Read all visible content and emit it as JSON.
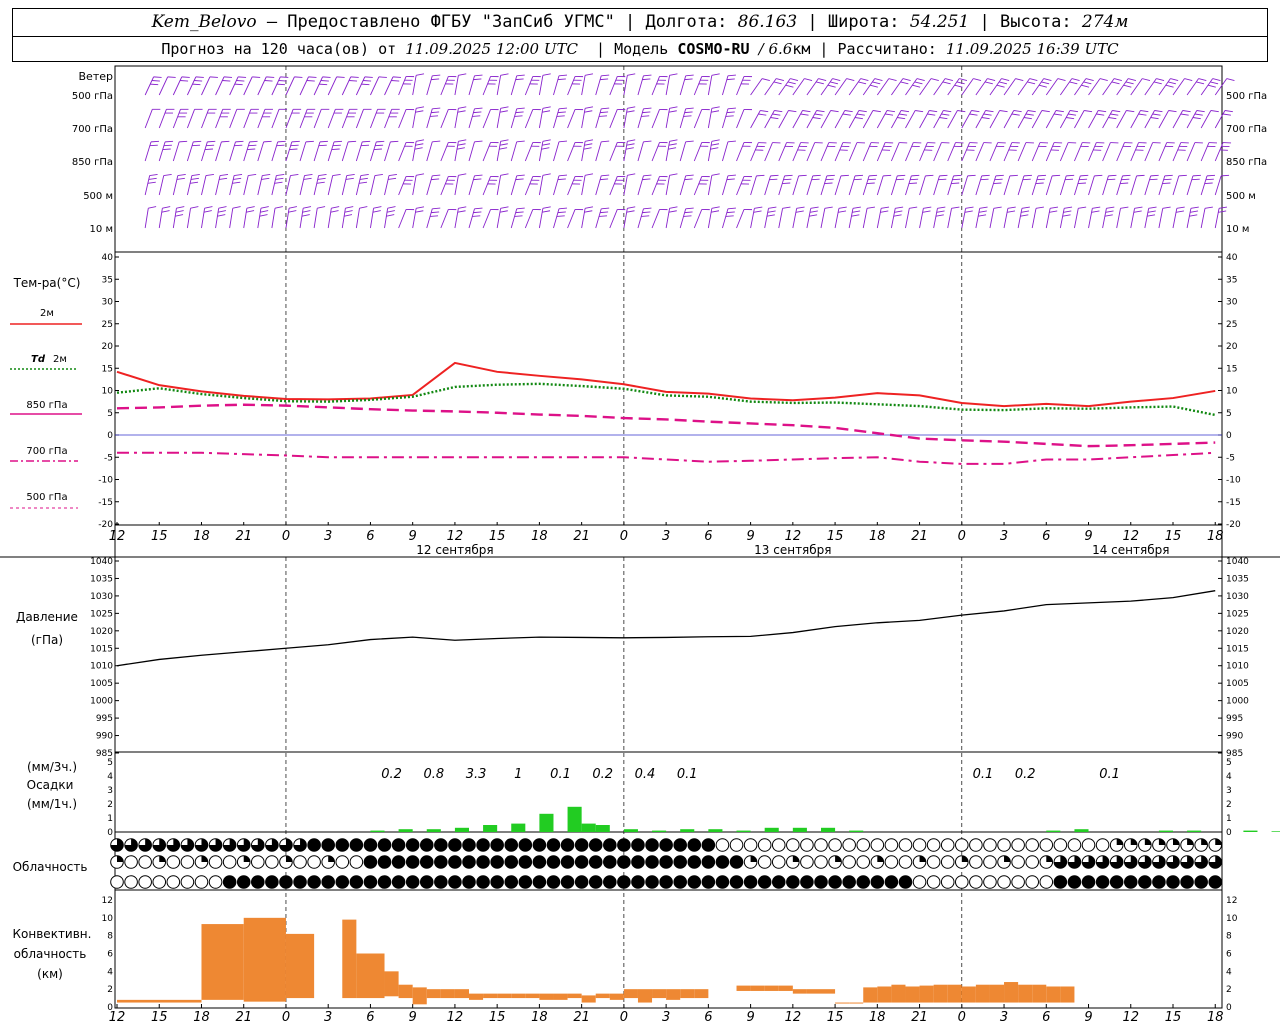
{
  "header": {
    "station": "Kem_Belovo",
    "provided_by": "– Предоставлено ФГБУ \"ЗапСиб УГМС\"",
    "lon_label": "Долгота:",
    "lon_value": "86.163",
    "lat_label": "Широта:",
    "lat_value": "54.251",
    "alt_label": "Высота:",
    "alt_value": "274м",
    "forecast_label": "Прогноз на 120 часа(ов) от",
    "forecast_from": "11.09.2025 12:00 UTC",
    "model_label": "Модель",
    "model_name": "COSMO-RU",
    "model_res": "/ 6.6",
    "model_unit": "км",
    "calc_label": "Рассчитано:",
    "calc_time": "11.09.2025 16:39 UTC"
  },
  "labels": {
    "wind_title": "Ветер",
    "wind_levels": [
      "500 гПа",
      "700 гПа",
      "850 гПа",
      "500 м",
      "10  м"
    ],
    "temp_title": "Тем-ра(°С)",
    "t2m": "2м",
    "td_a": "Td",
    "td_b": "2м",
    "t850": "850 гПа",
    "t700": "700 гПа",
    "t500": "500 гПа",
    "pressure_a": "Давление",
    "pressure_b": "(гПа)",
    "precip_a": "(мм/3ч.)",
    "precip_b": "Осадки",
    "precip_c": "(мм/1ч.)",
    "cloud": "Облачность",
    "conv_a": "Конвективн.",
    "conv_b": "облачность",
    "conv_c": "(км)"
  },
  "colors": {
    "t2m": "#ee2222",
    "td2m": "#118811",
    "t850": "#dd1188",
    "wind": "#8822cc",
    "precip": "#22cc22",
    "conv": "#ee8833",
    "zero_line": "#3333cc"
  },
  "chart_data": [
    {
      "type": "wind_barbs",
      "levels": [
        "500 гПа",
        "700 гПа",
        "850 гПа",
        "500 м",
        "10 м"
      ]
    },
    {
      "type": "line",
      "ylim": [
        -20,
        40
      ],
      "yticks": [
        -20,
        -15,
        -10,
        -5,
        0,
        5,
        10,
        15,
        20,
        25,
        30,
        35,
        40
      ],
      "x_hours_ticks": [
        0,
        3,
        6,
        9,
        12,
        15,
        18,
        21,
        24,
        27,
        30,
        33,
        36,
        39,
        42,
        45,
        48,
        51,
        54,
        57,
        60,
        63,
        66,
        69,
        72,
        75,
        78,
        81,
        84,
        87,
        90,
        93,
        96,
        99,
        102,
        105,
        108,
        111,
        114,
        117,
        120
      ],
      "x_tick_labels": [
        "12",
        "15",
        "18",
        "21",
        "0",
        "3",
        "6",
        "9",
        "12",
        "15",
        "18",
        "21",
        "0",
        "3",
        "6",
        "9",
        "12",
        "15",
        "18",
        "21",
        "0",
        "3",
        "6",
        "9",
        "12",
        "15",
        "18",
        "21",
        "0",
        "3",
        "6",
        "9",
        "12",
        "15",
        "18",
        "21",
        "0",
        "3",
        "6",
        "9",
        "12",
        "15",
        "18"
      ],
      "date_labels": [
        {
          "hour": 24,
          "text": "12 сентября"
        },
        {
          "hour": 48,
          "text": "13 сентября"
        },
        {
          "hour": 72,
          "text": "14 сентября"
        }
      ],
      "x": [
        0,
        3,
        6,
        9,
        12,
        15,
        18,
        21,
        24,
        27,
        30,
        33,
        36,
        39,
        42,
        45,
        48,
        51,
        54,
        57,
        60,
        63,
        66,
        69,
        72,
        75,
        78
      ],
      "series": [
        {
          "name": "2м",
          "values": [
            14.2,
            11.2,
            9.8,
            8.8,
            8.1,
            8.0,
            8.2,
            9.0,
            16.2,
            14.2,
            13.3,
            12.5,
            11.4,
            9.7,
            9.3,
            8.2,
            7.8,
            8.4,
            9.4,
            8.9,
            7.2,
            6.5,
            7.0,
            6.5,
            7.5,
            8.3,
            9.9
          ]
        },
        {
          "name": "Td 2м",
          "values": [
            9.5,
            10.5,
            9.2,
            8.3,
            7.6,
            7.5,
            7.9,
            8.6,
            10.8,
            11.3,
            11.5,
            11.0,
            10.4,
            8.9,
            8.6,
            7.5,
            7.2,
            7.3,
            6.9,
            6.5,
            5.7,
            5.6,
            6.0,
            5.9,
            6.2,
            6.4,
            4.5
          ]
        },
        {
          "name": "850 гПа",
          "values": [
            6.0,
            6.2,
            6.6,
            6.8,
            6.6,
            6.2,
            5.8,
            5.5,
            5.3,
            5.0,
            4.6,
            4.3,
            3.8,
            3.5,
            3.0,
            2.6,
            2.2,
            1.6,
            0.4,
            -0.8,
            -1.2,
            -1.5,
            -2.0,
            -2.5,
            -2.3,
            -2.0,
            -1.7
          ]
        },
        {
          "name": "700 гПа",
          "values": [
            -4.0,
            -4.0,
            -4.0,
            -4.3,
            -4.6,
            -5.0,
            -5.0,
            -5.0,
            -5.0,
            -5.0,
            -5.0,
            -5.0,
            -5.0,
            -5.5,
            -6.0,
            -5.8,
            -5.5,
            -5.2,
            -5.0,
            -6.0,
            -6.5,
            -6.5,
            -5.5,
            -5.5,
            -5.0,
            -4.5,
            -4.0
          ]
        }
      ]
    },
    {
      "type": "line",
      "title": "Давление",
      "ylabel": "(гПа)",
      "ylim": [
        985,
        1040
      ],
      "yticks": [
        985,
        990,
        995,
        1000,
        1005,
        1010,
        1015,
        1020,
        1025,
        1030,
        1035,
        1040
      ],
      "x": [
        0,
        3,
        6,
        9,
        12,
        15,
        18,
        21,
        24,
        27,
        30,
        33,
        36,
        39,
        42,
        45,
        48,
        51,
        54,
        57,
        60,
        63,
        66,
        69,
        72,
        75,
        78
      ],
      "values": [
        1010.0,
        1011.8,
        1013.0,
        1014.0,
        1015.0,
        1016.0,
        1017.5,
        1018.2,
        1017.3,
        1017.8,
        1018.2,
        1018.1,
        1018.0,
        1018.1,
        1018.3,
        1018.4,
        1019.5,
        1021.2,
        1022.3,
        1023.0,
        1024.5,
        1025.7,
        1027.5,
        1028.0,
        1028.5,
        1029.5,
        1031.5
      ]
    },
    {
      "type": "bar",
      "ylim": [
        0,
        5
      ],
      "yticks": [
        0,
        1,
        2,
        3,
        4,
        5
      ],
      "x": [
        18,
        20,
        22,
        24,
        26,
        28,
        30,
        32,
        33,
        34,
        36,
        38,
        40,
        42,
        44,
        46,
        48,
        50,
        52,
        66,
        68,
        74,
        76,
        80,
        82
      ],
      "values": [
        0.1,
        0.2,
        0.2,
        0.3,
        0.5,
        0.6,
        1.3,
        1.8,
        0.6,
        0.5,
        0.2,
        0.1,
        0.2,
        0.2,
        0.1,
        0.3,
        0.3,
        0.3,
        0.1,
        0.1,
        0.2,
        0.1,
        0.1,
        0.1,
        0.05
      ],
      "sum_labels": [
        {
          "hour": 19.5,
          "text": "0.2"
        },
        {
          "hour": 22.5,
          "text": "0.8"
        },
        {
          "hour": 25.5,
          "text": "3.3"
        },
        {
          "hour": 28.5,
          "text": "1"
        },
        {
          "hour": 31.5,
          "text": "0.1"
        },
        {
          "hour": 34.5,
          "text": "0.2"
        },
        {
          "hour": 37.5,
          "text": "0.4"
        },
        {
          "hour": 40.5,
          "text": "0.1"
        },
        {
          "hour": 61.5,
          "text": "0.1"
        },
        {
          "hour": 64.5,
          "text": "0.2"
        },
        {
          "hour": 70.5,
          "text": "0.1"
        }
      ]
    },
    {
      "type": "cloud_symbols",
      "rows": [
        "upper",
        "middle",
        "lower"
      ]
    },
    {
      "type": "bar",
      "ylim": [
        0,
        12
      ],
      "yticks": [
        0,
        2,
        4,
        6,
        8,
        10,
        12
      ],
      "x_start": [
        12,
        18,
        21,
        24,
        28,
        29,
        31,
        32,
        33,
        34,
        35,
        36,
        37,
        38,
        39,
        40,
        41,
        42,
        43,
        44,
        45,
        46,
        47,
        48,
        49,
        50,
        51,
        52,
        53,
        56,
        57,
        58,
        59,
        60,
        61,
        62,
        63,
        64,
        65,
        66,
        67,
        68,
        69,
        70,
        71,
        72,
        73,
        74,
        75,
        76,
        77,
        78,
        79
      ],
      "x_end": [
        18,
        21,
        24,
        26,
        29,
        31,
        32,
        33,
        34,
        35,
        36,
        37,
        38,
        39,
        40,
        41,
        42,
        43,
        44,
        45,
        46,
        47,
        48,
        49,
        50,
        51,
        52,
        53,
        54,
        57,
        58,
        59,
        60,
        61,
        62,
        63,
        64,
        65,
        66,
        67,
        68,
        69,
        70,
        71,
        72,
        73,
        74,
        75,
        76,
        77,
        78,
        79,
        80
      ],
      "bottoms": [
        0.5,
        0.8,
        0.6,
        1.0,
        1.0,
        1.0,
        1.2,
        1.0,
        0.3,
        1.0,
        1.0,
        1.0,
        0.8,
        1.0,
        1.0,
        1.0,
        1.0,
        0.8,
        0.8,
        1.0,
        0.5,
        1.0,
        0.8,
        1.0,
        0.5,
        1.0,
        0.8,
        1.0,
        1.0,
        1.8,
        1.8,
        1.8,
        1.8,
        1.5,
        1.5,
        1.5,
        0.5,
        0.5,
        0.5,
        0.5,
        0.5,
        0.5,
        0.5,
        0.5,
        0.5,
        0.5,
        0.5,
        0.5,
        0.5,
        0.5,
        0.5,
        0.5,
        0.5
      ],
      "tops": [
        0.8,
        9.3,
        10.0,
        8.2,
        9.8,
        6.0,
        4.0,
        2.5,
        2.2,
        2.0,
        2.0,
        2.0,
        1.5,
        1.5,
        1.5,
        1.5,
        1.5,
        1.5,
        1.5,
        1.5,
        1.3,
        1.5,
        1.5,
        2.0,
        2.0,
        2.0,
        2.0,
        2.0,
        2.0,
        2.4,
        2.4,
        2.4,
        2.4,
        2.0,
        2.0,
        2.0,
        0.5,
        0.5,
        2.2,
        2.3,
        2.5,
        2.3,
        2.4,
        2.5,
        2.5,
        2.3,
        2.5,
        2.5,
        2.8,
        2.5,
        2.5,
        2.3,
        2.3
      ]
    }
  ]
}
